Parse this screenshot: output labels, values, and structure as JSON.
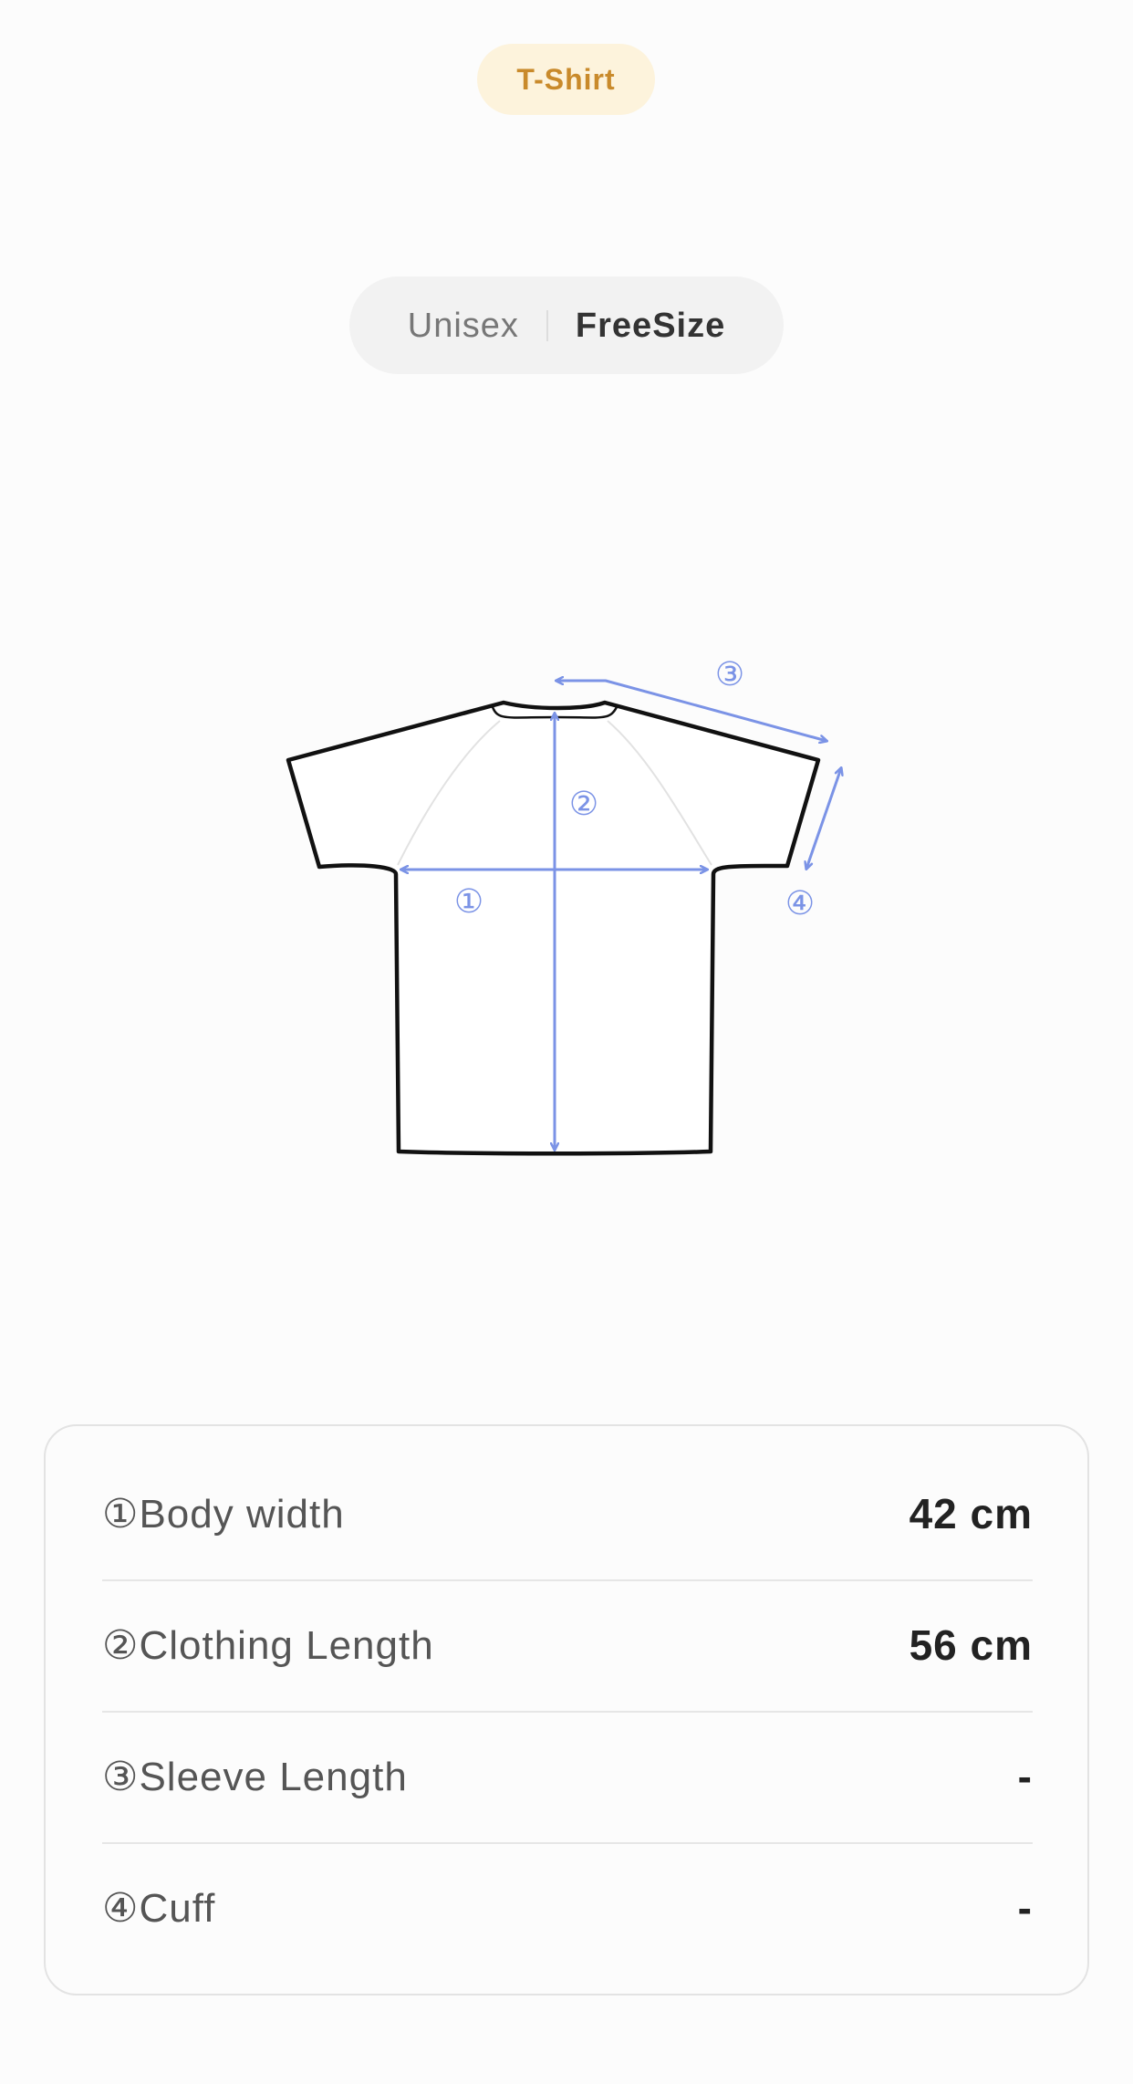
{
  "category": {
    "label": "T-Shirt",
    "accent_color": "#c98a2b",
    "background_color": "#fdf3dc"
  },
  "size_selector": {
    "gender": "Unisex",
    "size": "FreeSize"
  },
  "diagram": {
    "markers": {
      "body_width": "①",
      "clothing_length": "②",
      "sleeve_length": "③",
      "cuff": "④"
    },
    "arrow_color": "#7b93e6"
  },
  "measurements": [
    {
      "label": "①Body width",
      "value": "42 cm"
    },
    {
      "label": "②Clothing Length",
      "value": "56 cm"
    },
    {
      "label": "③Sleeve Length",
      "value": "-"
    },
    {
      "label": "④Cuff",
      "value": "-"
    }
  ]
}
